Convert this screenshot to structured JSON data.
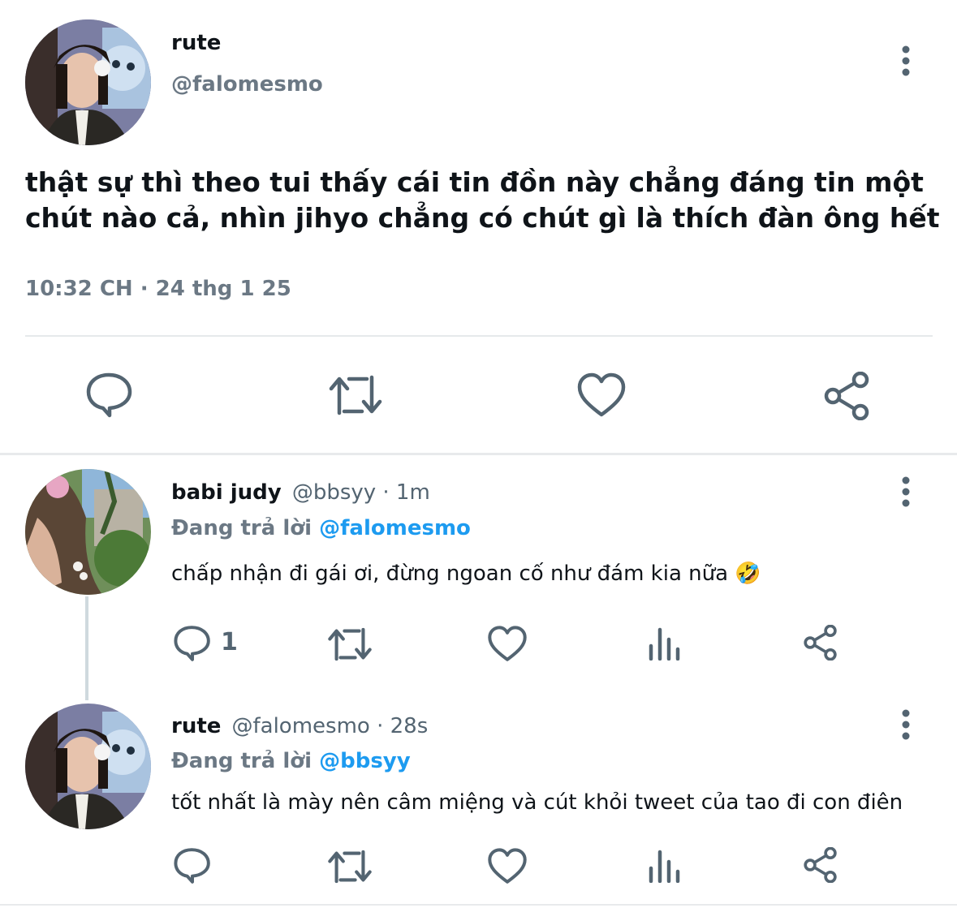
{
  "main_tweet": {
    "name": "rute",
    "handle": "@falomesmo",
    "text_line1": "thật sự thì theo tui thấy cái tin đồn này chẳng đáng tin một",
    "text_line2": "chút nào cả, nhìn jihyo chẳng có chút gì là thích đàn ông hết",
    "timestamp": "10:32 CH · 24 thg 1 25",
    "actions": [
      "reply-icon",
      "retweet-icon",
      "like-icon",
      "share-icon"
    ]
  },
  "replies": [
    {
      "name": "babi judy",
      "meta": "@bbsyy · 1m",
      "replying_prefix": "Đang trả lời",
      "replying_to": "@falomesmo",
      "text": "chấp nhận đi gái ơi, đừng ngoan cố như đám kia nữa 🤣",
      "reply_count": "1"
    },
    {
      "name": "rute",
      "meta": "@falomesmo · 28s",
      "replying_prefix": "Đang trả lời",
      "replying_to": "@bbsyy",
      "text": "tốt nhất là mày nên câm miệng và cút khỏi tweet của tao đi con điên",
      "reply_count": ""
    }
  ],
  "colors": {
    "text": "#0f1419",
    "muted": "#536471",
    "accent": "#1d9bf0",
    "divider": "#e6e9eb"
  }
}
